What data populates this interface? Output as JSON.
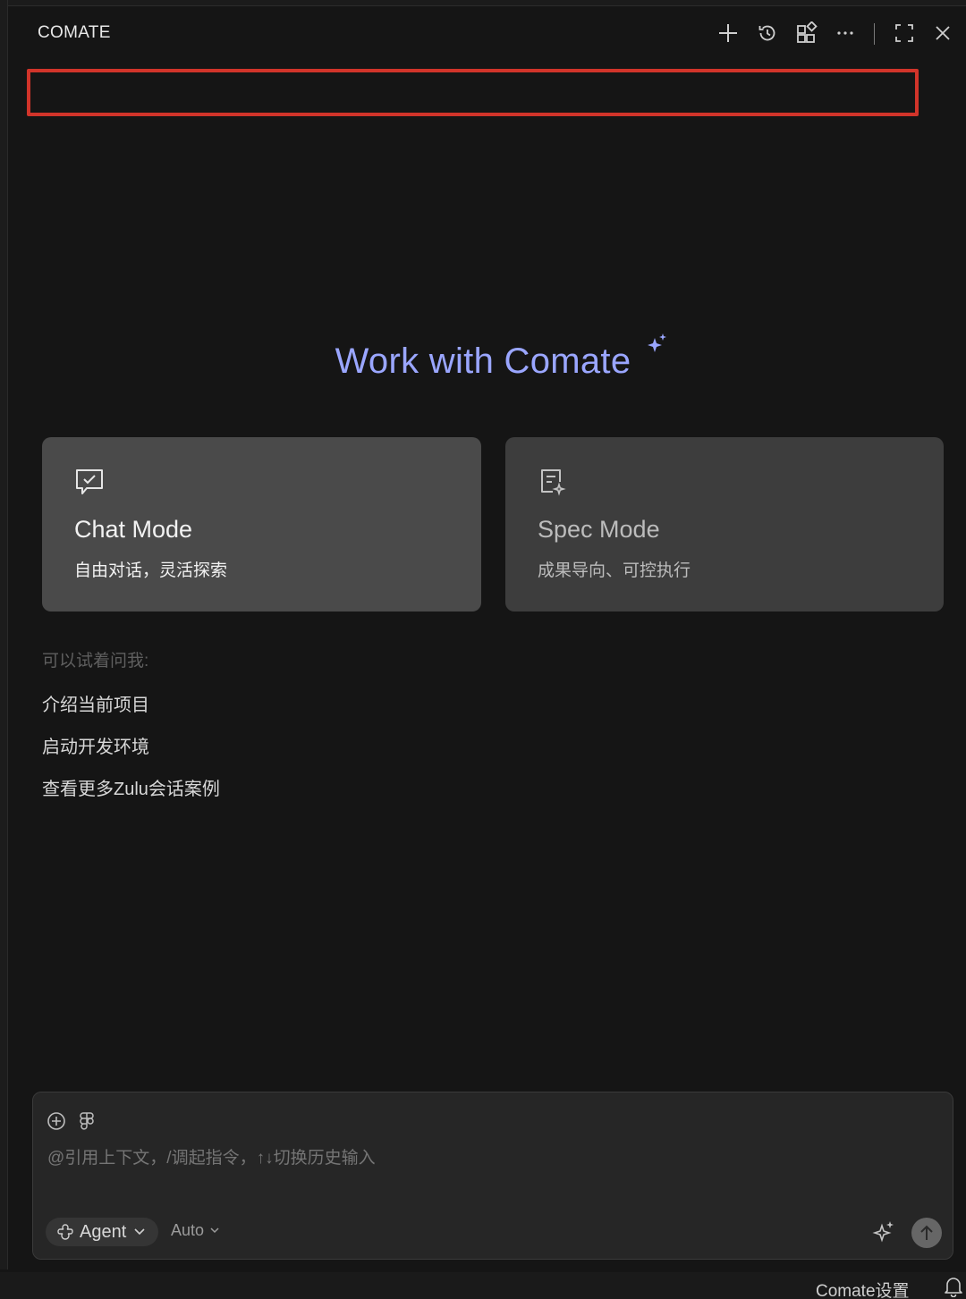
{
  "header": {
    "title": "COMATE",
    "icons": [
      "plus-icon",
      "history-icon",
      "apps-icon",
      "more-icon",
      "fullscreen-icon",
      "close-icon"
    ]
  },
  "hero": {
    "title": "Work with Comate"
  },
  "modes": [
    {
      "title": "Chat Mode",
      "subtitle": "自由对话，灵活探索",
      "icon": "chat-check-icon"
    },
    {
      "title": "Spec Mode",
      "subtitle": "成果导向、可控执行",
      "icon": "spec-doc-icon"
    }
  ],
  "suggestions": {
    "label": "可以试着问我:",
    "items": [
      "介绍当前项目",
      "启动开发环境",
      "查看更多Zulu会话案例"
    ]
  },
  "composer": {
    "placeholder": "@引用上下文，/调起指令，↑↓切换历史输入",
    "agent_label": "Agent",
    "model_label": "Auto"
  },
  "status_bar": {
    "settings_label": "Comate设置"
  },
  "colors": {
    "background": "#151515",
    "accent": "#9aa6ff",
    "highlight_border": "#d1342a",
    "card_active": "#4a4a4a",
    "card_inactive": "#3d3d3d"
  }
}
